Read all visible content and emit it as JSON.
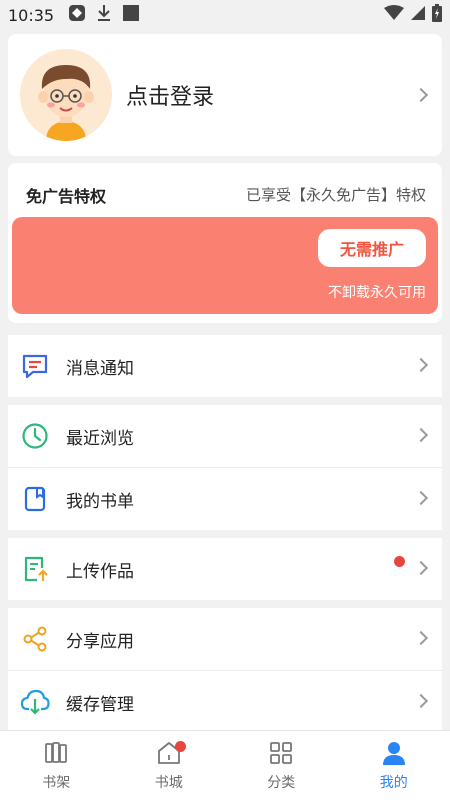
{
  "status_bar": {
    "time": "10:35",
    "icons": [
      "app-notification-icon",
      "download-icon",
      "square-icon",
      "wifi-icon",
      "signal-icon",
      "battery-icon"
    ]
  },
  "profile": {
    "login_label": "点击登录"
  },
  "vip": {
    "title": "免广告特权",
    "status": "已享受【永久免广告】特权",
    "button_label": "无需推广",
    "subtitle": "不卸载永久可用",
    "color": "#fa8172"
  },
  "menu": {
    "notifications": "消息通知",
    "history": "最近浏览",
    "booklist": "我的书单",
    "upload": "上传作品",
    "share": "分享应用",
    "cache": "缓存管理"
  },
  "bottom_nav": {
    "bookshelf": "书架",
    "bookstore": "书城",
    "category": "分类",
    "mine": "我的",
    "active_color": "#2b84f4"
  }
}
